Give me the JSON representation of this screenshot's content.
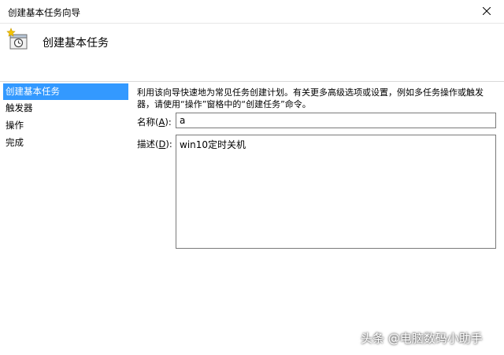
{
  "window": {
    "title": "创建基本任务向导",
    "close_icon": "close-icon"
  },
  "header": {
    "icon": "scheduled-task-icon",
    "title": "创建基本任务"
  },
  "steps": [
    {
      "label": "创建基本任务",
      "active": true
    },
    {
      "label": "触发器",
      "active": false
    },
    {
      "label": "操作",
      "active": false
    },
    {
      "label": "完成",
      "active": false
    }
  ],
  "main": {
    "description": "利用该向导快速地为常见任务创建计划。有关更多高级选项或设置，例如多任务操作或触发器，请使用“操作”窗格中的“创建任务”命令。",
    "name_label_prefix": "名称(",
    "name_label_key": "A",
    "name_label_suffix": "):",
    "name_value": "a",
    "desc_label_prefix": "描述(",
    "desc_label_key": "D",
    "desc_label_suffix": "):",
    "desc_value": "win10定时关机"
  },
  "watermark": "头条 @电脑数码小助手",
  "colors": {
    "active_step_bg": "#3399ff",
    "input_border": "#7a7a7a"
  }
}
